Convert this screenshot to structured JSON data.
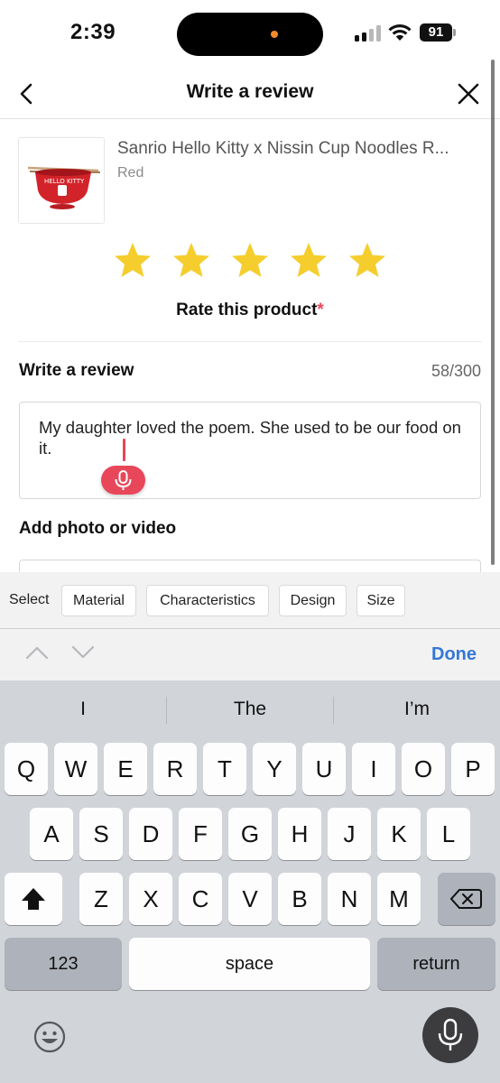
{
  "status": {
    "time": "2:39",
    "battery": "91",
    "island_dot_color": "#f28a2c"
  },
  "header": {
    "title": "Write a review",
    "back_icon": "chevron-left-icon",
    "close_icon": "close-icon"
  },
  "product": {
    "name": "Sanrio Hello Kitty x Nissin Cup Noodles R...",
    "variant": "Red"
  },
  "rating": {
    "stars_filled": 5,
    "stars_total": 5,
    "label": "Rate this product",
    "required_mark": "*",
    "star_color": "#f5cd2d"
  },
  "review": {
    "label": "Write a review",
    "count": "58/300",
    "text": "My daughter loved the poem. She used to be our food on it."
  },
  "photo": {
    "label": "Add photo or video"
  },
  "suggestions": {
    "label": "Select",
    "chips": [
      "Material",
      "Characteristics",
      "Design",
      "Size"
    ]
  },
  "keyboard_toolbar": {
    "done": "Done",
    "accent_color": "#3478d6"
  },
  "keyboard": {
    "predictions": [
      "I",
      "The",
      "I’m"
    ],
    "row1": [
      "Q",
      "W",
      "E",
      "R",
      "T",
      "Y",
      "U",
      "I",
      "O",
      "P"
    ],
    "row2": [
      "A",
      "S",
      "D",
      "F",
      "G",
      "H",
      "J",
      "K",
      "L"
    ],
    "row3": [
      "Z",
      "X",
      "C",
      "V",
      "B",
      "N",
      "M"
    ],
    "numbers_label": "123",
    "space_label": "space",
    "return_label": "return"
  },
  "accent_color": "#e8475a"
}
